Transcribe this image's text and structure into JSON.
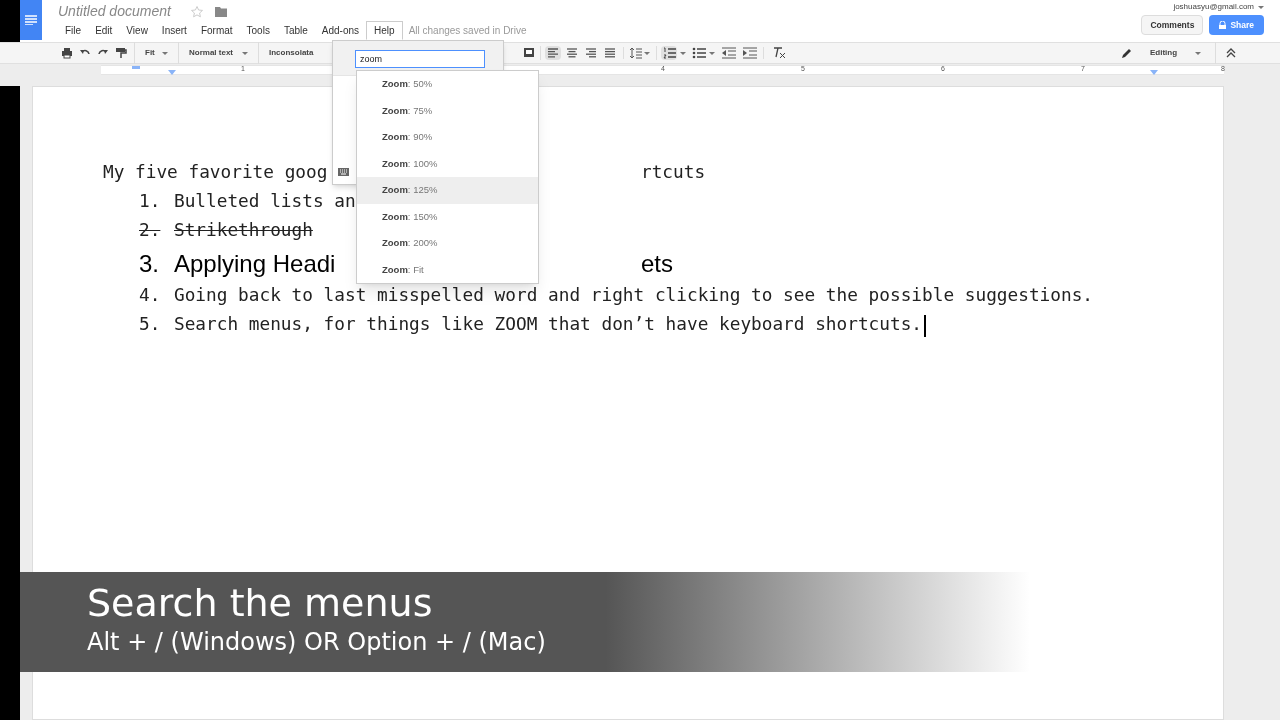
{
  "document": {
    "title": "Untitled document",
    "save_status": "All changes saved in Drive"
  },
  "menu": [
    {
      "label": "File",
      "selected": false
    },
    {
      "label": "Edit",
      "selected": false
    },
    {
      "label": "View",
      "selected": false
    },
    {
      "label": "Insert",
      "selected": false
    },
    {
      "label": "Format",
      "selected": false
    },
    {
      "label": "Tools",
      "selected": false
    },
    {
      "label": "Table",
      "selected": false
    },
    {
      "label": "Add-ons",
      "selected": false
    },
    {
      "label": "Help",
      "selected": true
    }
  ],
  "account": {
    "email": "joshuasyu@gmail.com",
    "comments": "Comments",
    "share": "Share"
  },
  "toolbar": {
    "zoom": "Fit",
    "style": "Normal text",
    "font": "Inconsolata",
    "align_left_selected": true,
    "numbered_list_selected": true,
    "mode": "Editing"
  },
  "ruler": [
    "1",
    "4",
    "5",
    "6",
    "7",
    "8"
  ],
  "help_search": {
    "value": "zoom",
    "results": [
      {
        "label": "**Zoom**: 50%",
        "selected": false
      },
      {
        "label": "**Zoom**: 75%",
        "selected": false
      },
      {
        "label": "**Zoom**: 90%",
        "selected": false
      },
      {
        "label": "**Zoom**: 100%",
        "selected": false
      },
      {
        "label": "**Zoom**: 125%",
        "selected": true
      },
      {
        "label": "**Zoom**: 150%",
        "selected": false
      },
      {
        "label": "**Zoom**: 200%",
        "selected": false
      },
      {
        "label": "**Zoom**: Fit",
        "selected": false
      }
    ]
  },
  "lines": [
    {
      "kind": "normal",
      "text": "My five favorite goog",
      "tail": "rtcuts"
    },
    {
      "kind": "normal",
      "number": "1.",
      "text": "Bulleted lists an"
    },
    {
      "kind": "strikethrough",
      "number": "2.",
      "text": "Strikethrough"
    },
    {
      "kind": "heading",
      "number": "3.",
      "text": "Applying Headi",
      "tail": "ets"
    },
    {
      "kind": "normal",
      "number": "4.",
      "text": "Going back to last misspelled word and right clicking to see the possible suggestions."
    },
    {
      "kind": "normal",
      "number": "5.",
      "text": "Search menus, for things like ZOOM that don’t have keyboard shortcuts.",
      "cursor": true
    }
  ],
  "caption": {
    "title": "Search the menus",
    "subtitle": "Alt + / (Windows) OR Option + / (Mac)"
  }
}
